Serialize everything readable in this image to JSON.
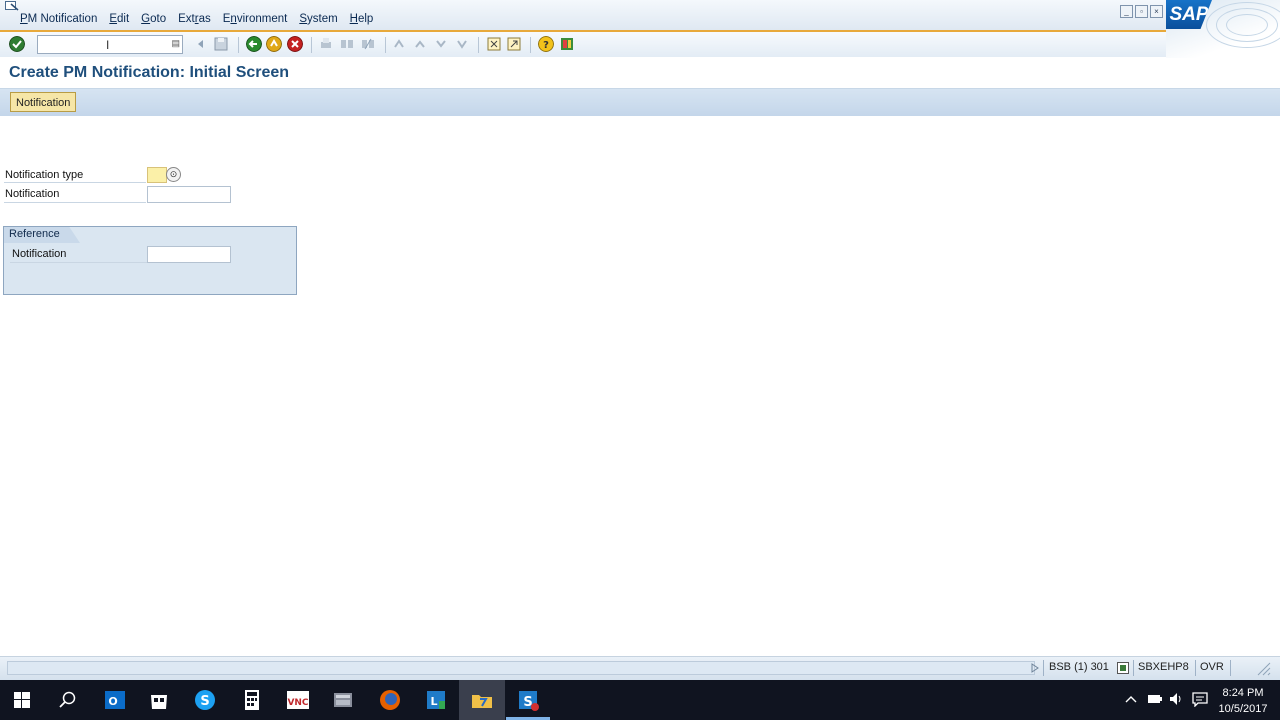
{
  "menu": {
    "items": [
      {
        "pre": "",
        "ul": "P",
        "post": "M Notification"
      },
      {
        "pre": "",
        "ul": "E",
        "post": "dit"
      },
      {
        "pre": "",
        "ul": "G",
        "post": "oto"
      },
      {
        "pre": "Ext",
        "ul": "r",
        "post": "as"
      },
      {
        "pre": "E",
        "ul": "n",
        "post": "vironment"
      },
      {
        "pre": "",
        "ul": "S",
        "post": "ystem"
      },
      {
        "pre": "",
        "ul": "H",
        "post": "elp"
      }
    ],
    "logo_text": "SAP"
  },
  "toolbar": {
    "command_field_value": "",
    "icons": [
      "enter-icon",
      "save-icon",
      "back-icon",
      "exit-icon",
      "cancel-icon",
      "print-icon",
      "find-icon",
      "find-next-icon",
      "first-page-icon",
      "previous-page-icon",
      "next-page-icon",
      "last-page-icon",
      "new-session-icon",
      "shortcut-icon",
      "help-icon",
      "customize-layout-icon"
    ]
  },
  "title": "Create PM Notification: Initial Screen",
  "app_toolbar": {
    "notification_button": "Notification"
  },
  "form": {
    "notification_type_label": "Notification type",
    "notification_type_value": "",
    "notification_label": "Notification",
    "notification_value": "",
    "reference": {
      "title": "Reference",
      "notification_label": "Notification",
      "notification_value": ""
    }
  },
  "statusbar": {
    "system": "BSB (1) 301",
    "server": "SBXEHP8",
    "mode": "OVR"
  },
  "taskbar": {
    "time": "8:24 PM",
    "date": "10/5/2017"
  },
  "colors": {
    "title": "#1f4f7c",
    "toolbar_accent": "#e8a93b",
    "required_field": "#fbf0a8",
    "group_box": "#dae6f1"
  }
}
